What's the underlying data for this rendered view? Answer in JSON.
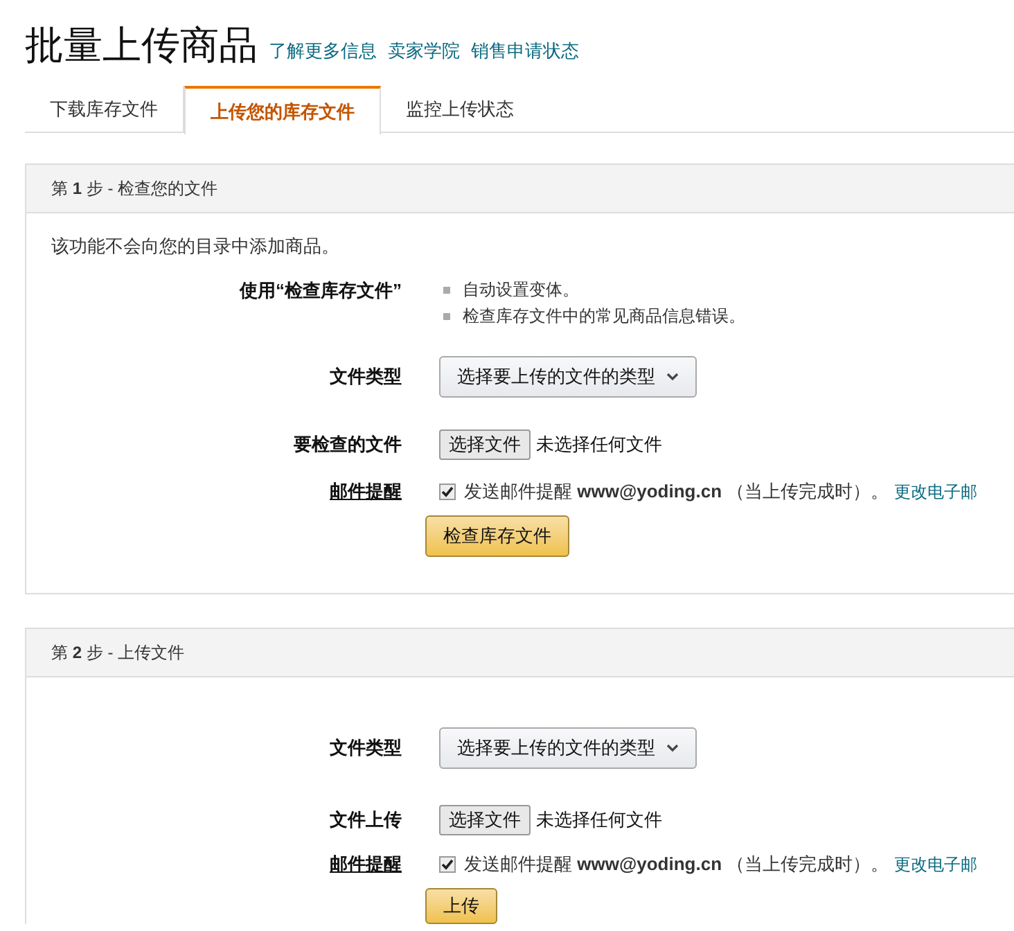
{
  "page_title": "批量上传商品",
  "header_links": [
    "了解更多信息",
    "卖家学院",
    "销售申请状态"
  ],
  "tabs": [
    {
      "label": "下载库存文件",
      "selected": false
    },
    {
      "label": "上传您的库存文件",
      "selected": true
    },
    {
      "label": "监控上传状态",
      "selected": false
    }
  ],
  "steps": [
    {
      "title": "第 **1** 步 - 检查您的文件",
      "intro": "该功能不会向您的目录中添加商品。",
      "rows": [
        {
          "kind": "bullets",
          "label": "使用“检查库存文件”",
          "items": [
            "自动设置变体。",
            "检查库存文件中的常见商品信息错误。"
          ]
        },
        {
          "kind": "select",
          "label": "文件类型",
          "value": "选择要上传的文件的类型"
        },
        {
          "kind": "file",
          "label": "要检查的文件",
          "button": "选择文件",
          "status": "未选择任何文件"
        },
        {
          "kind": "email",
          "label": "邮件提醒",
          "checked": true,
          "text": "发送邮件提醒 **www@yoding.cn** （当上传完成时）。",
          "link": "更改电子邮"
        }
      ],
      "action": "检查库存文件"
    },
    {
      "title": "第 **2** 步 - 上传文件",
      "rows": [
        {
          "kind": "select",
          "label": "文件类型",
          "value": "选择要上传的文件的类型"
        },
        {
          "kind": "file",
          "label": "文件上传",
          "button": "选择文件",
          "status": "未选择任何文件"
        },
        {
          "kind": "email",
          "label": "邮件提醒",
          "checked": true,
          "text": "发送邮件提醒 **www@yoding.cn** （当上传完成时）。",
          "link": "更改电子邮"
        }
      ],
      "action": "上传"
    }
  ]
}
